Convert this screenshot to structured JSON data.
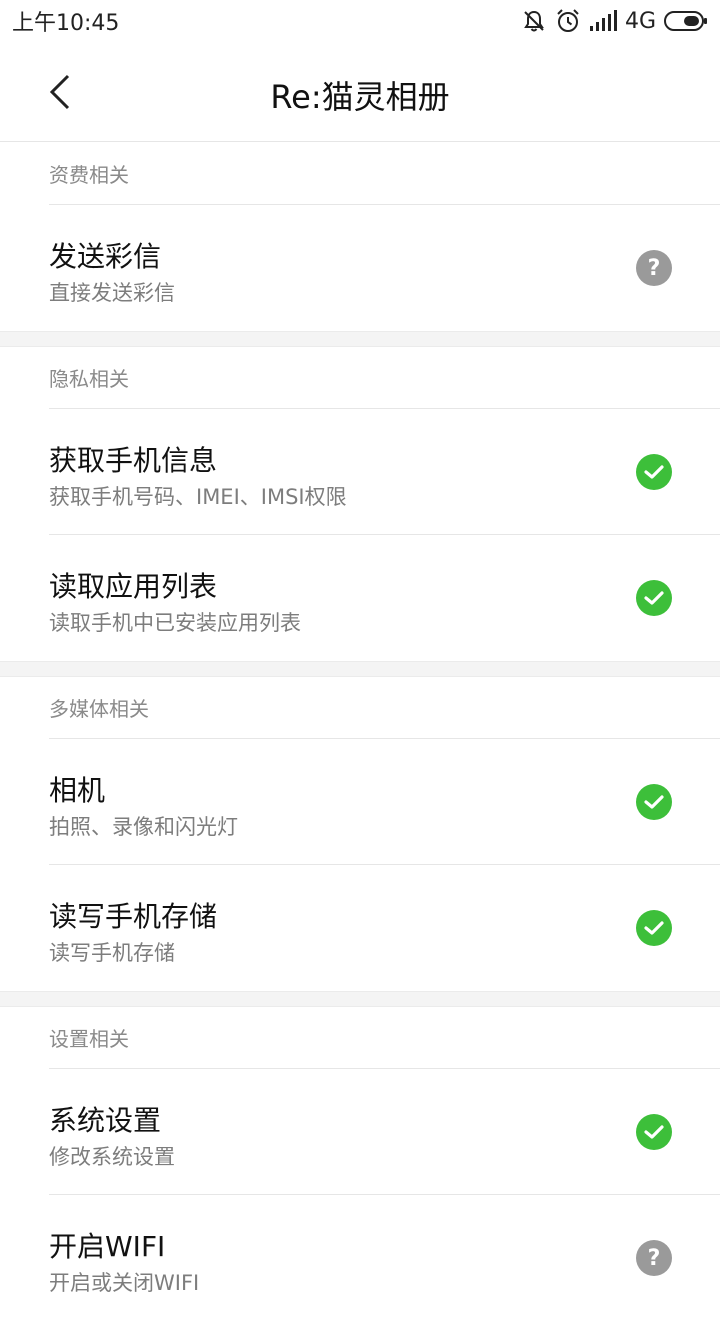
{
  "status_bar": {
    "time": "上午10:45",
    "network": "4G",
    "icons": [
      "mute-bell-icon",
      "alarm-icon",
      "signal-icon",
      "battery-icon"
    ]
  },
  "header": {
    "title": "Re:猫灵相册",
    "back_icon": "back-chevron-icon"
  },
  "colors": {
    "granted": "#3dbf3a",
    "ask": "#9a9a9a",
    "section_header_text": "#8a8a8a",
    "description_text": "#7d7d7d"
  },
  "sections": [
    {
      "header": "资费相关",
      "items": [
        {
          "title": "发送彩信",
          "desc": "直接发送彩信",
          "status": "ask"
        }
      ]
    },
    {
      "header": "隐私相关",
      "items": [
        {
          "title": "获取手机信息",
          "desc": "获取手机号码、IMEI、IMSI权限",
          "status": "granted"
        },
        {
          "title": "读取应用列表",
          "desc": "读取手机中已安装应用列表",
          "status": "granted"
        }
      ]
    },
    {
      "header": "多媒体相关",
      "items": [
        {
          "title": "相机",
          "desc": "拍照、录像和闪光灯",
          "status": "granted"
        },
        {
          "title": "读写手机存储",
          "desc": "读写手机存储",
          "status": "granted"
        }
      ]
    },
    {
      "header": "设置相关",
      "items": [
        {
          "title": "系统设置",
          "desc": "修改系统设置",
          "status": "granted"
        },
        {
          "title": "开启WIFI",
          "desc": "开启或关闭WIFI",
          "status": "ask"
        }
      ]
    }
  ]
}
